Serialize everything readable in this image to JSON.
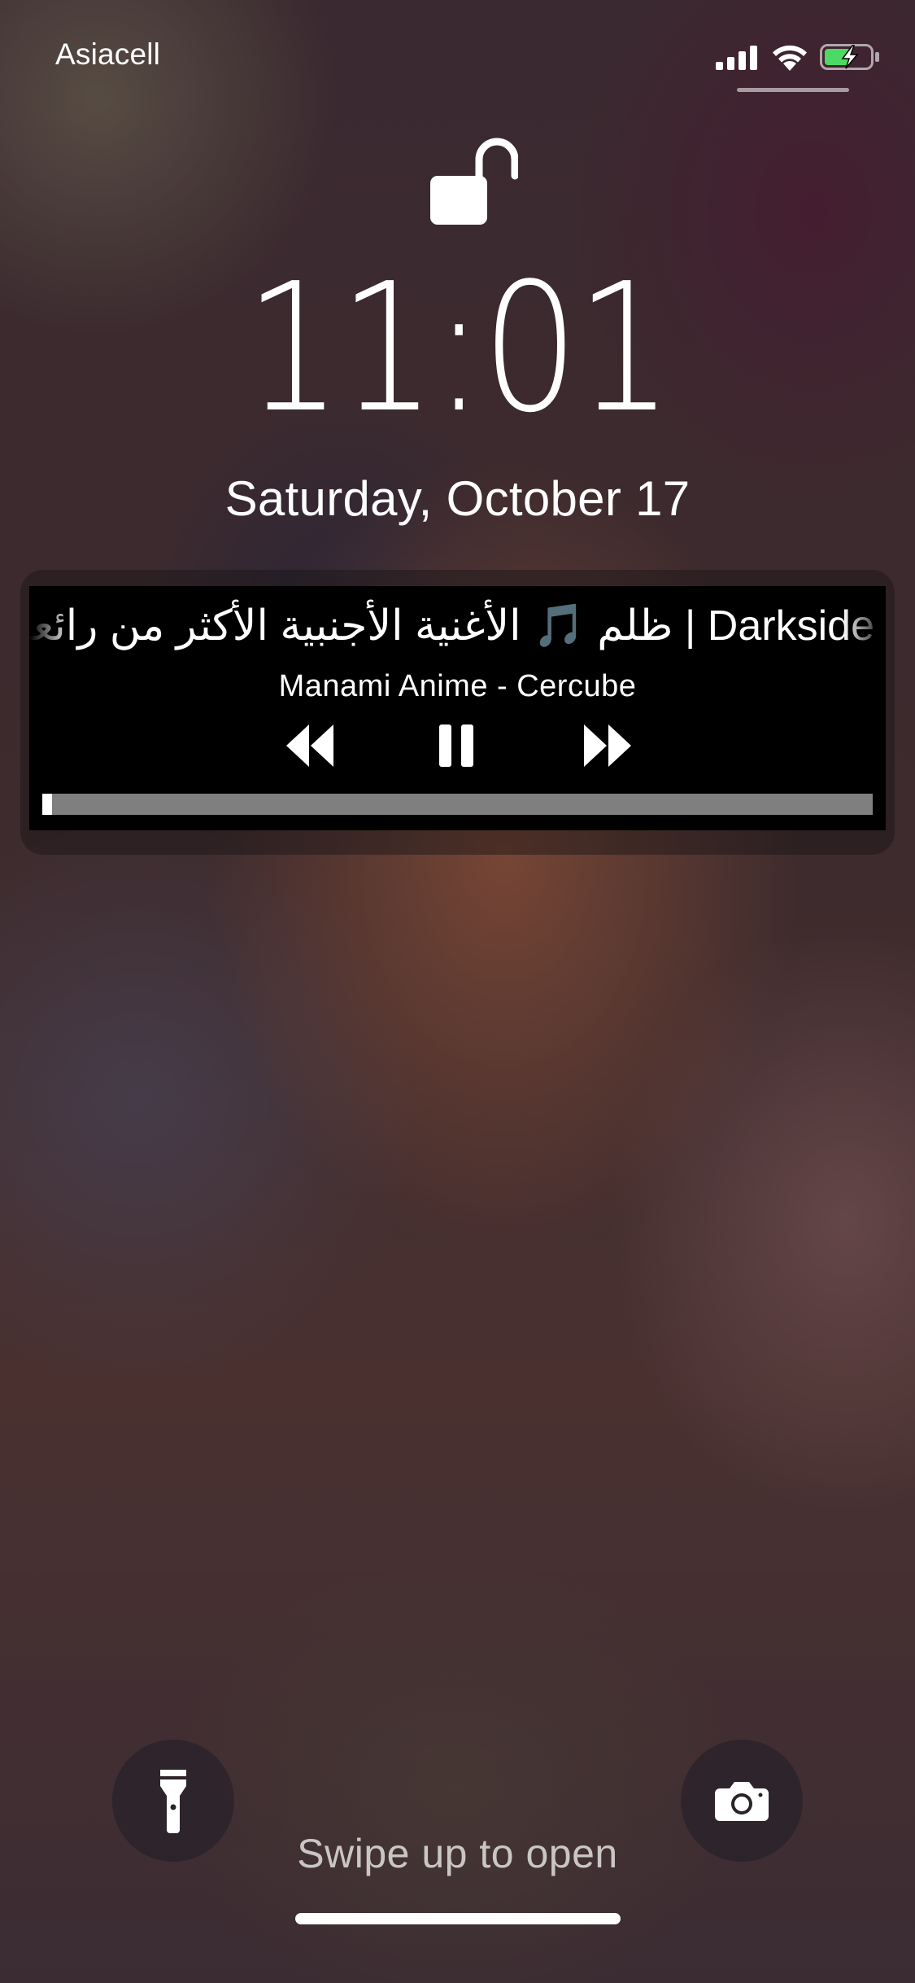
{
  "status_bar": {
    "carrier": "Asiacell",
    "signal_icon": "cellular-signal-icon",
    "wifi_icon": "wifi-icon",
    "battery_icon": "battery-charging-icon",
    "battery_color": "#4cd964"
  },
  "lock": {
    "icon": "unlocked-padlock-icon",
    "time": "11:01",
    "date": "Saturday, October 17"
  },
  "now_playing": {
    "title": "ظلم 🎵 الأغنية الأجنبية الأكثر من رائعة | Darkside",
    "artist": "Manami Anime - Cercube",
    "prev_icon": "rewind-icon",
    "pause_icon": "pause-icon",
    "next_icon": "fast-forward-icon",
    "progress": 0.012
  },
  "bottom": {
    "flashlight_icon": "flashlight-icon",
    "camera_icon": "camera-icon",
    "swipe_hint": "Swipe up to open"
  }
}
